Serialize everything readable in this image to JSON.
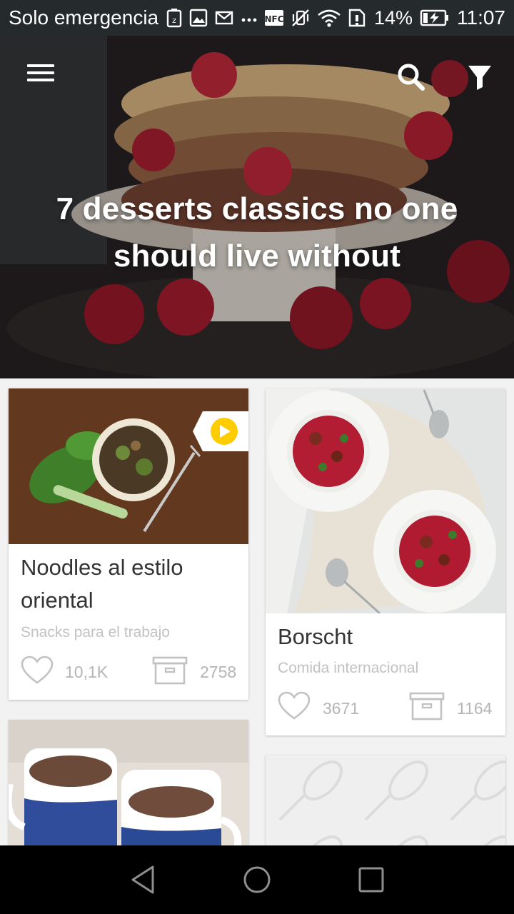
{
  "status_bar": {
    "carrier": "Solo emergencia",
    "battery_percent": "14%",
    "time": "11:07",
    "icons": [
      "data-saver-icon",
      "image-icon",
      "mail-icon",
      "more-dots-icon",
      "nfc-icon",
      "vibrate-off-icon",
      "wifi-icon",
      "sim-alert-icon",
      "battery-charging-icon"
    ]
  },
  "header": {
    "menu_icon": "hamburger-menu-icon",
    "search_icon": "search-icon",
    "filter_icon": "filter-icon",
    "featured_title": "7 desserts classics no one should live without"
  },
  "cards": [
    {
      "title_line1": "Noodles al estilo",
      "title_line2": "oriental",
      "category": "Snacks para el trabajo",
      "likes": "10,1K",
      "saves": "2758",
      "has_video": true,
      "video_icon": "play-icon"
    },
    {
      "title": "Borscht",
      "category": "Comida internacional",
      "likes": "3671",
      "saves": "1164"
    }
  ],
  "card_icons": {
    "like": "heart-icon",
    "save": "archive-box-icon"
  },
  "nav_bar": {
    "back": "back-icon",
    "home": "home-icon",
    "recents": "recents-icon"
  },
  "colors": {
    "status_bar_bg": "#252a2c",
    "play_badge": "#ffcc00",
    "card_title": "#333333",
    "card_meta": "#b5b5b5"
  }
}
